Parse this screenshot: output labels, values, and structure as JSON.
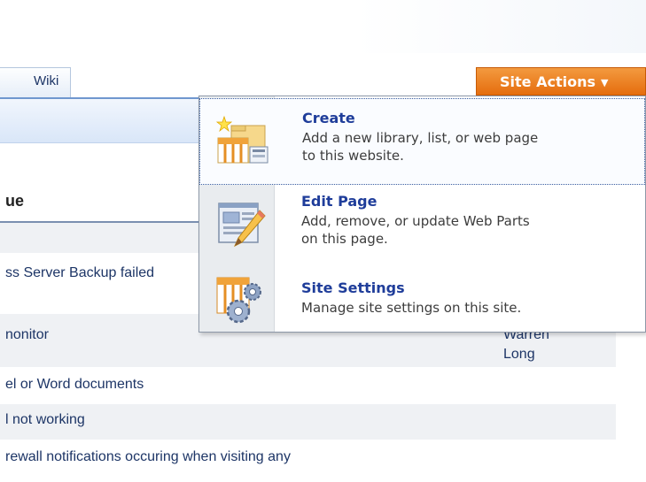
{
  "tabs": {
    "wiki_label": "Wiki"
  },
  "list": {
    "column_heading": "ue",
    "rows": [
      "ss Server Backup failed",
      "nonitor",
      "el or Word documents",
      "l not working",
      "rewall notifications occuring when visiting any"
    ],
    "assignee_line1": "Warren",
    "assignee_line2": "Long"
  },
  "site_actions": {
    "label": "Site Actions",
    "caret": "▼",
    "color": "#e87a1e",
    "menu": [
      {
        "title": "Create",
        "desc_line1": "Add a new library, list, or web page",
        "desc_line2": "to this website.",
        "icon": "create-icon"
      },
      {
        "title": "Edit Page",
        "desc_line1": "Add, remove, or update Web Parts",
        "desc_line2": "on this page.",
        "icon": "edit-page-icon"
      },
      {
        "title": "Site Settings",
        "desc_line1": "Manage site settings on this site.",
        "icon": "site-settings-icon"
      }
    ]
  }
}
